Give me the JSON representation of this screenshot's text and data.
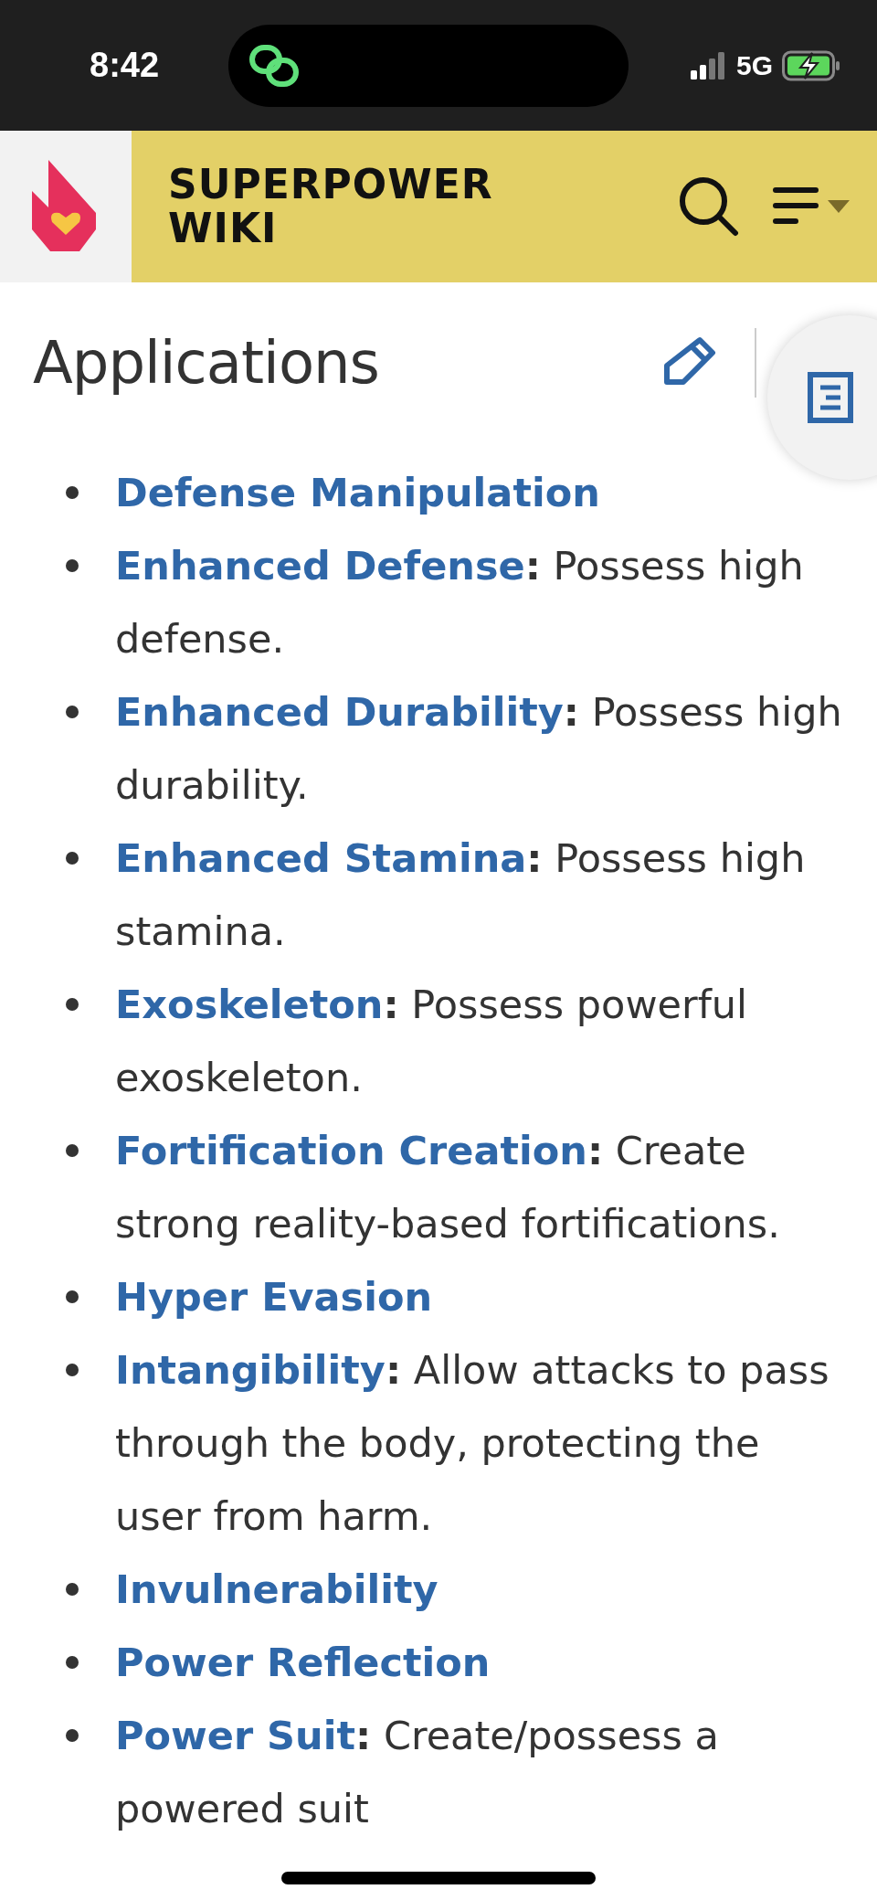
{
  "status_bar": {
    "time": "8:42",
    "network": "5G"
  },
  "header": {
    "title": "SUPERPOWER WIKI"
  },
  "section": {
    "heading": "Applications"
  },
  "items": [
    {
      "link": "Defense Manipulation"
    },
    {
      "link": "Enhanced Defense",
      "separator": ":",
      "text": "Possess high defense."
    },
    {
      "link": "Enhanced Durability",
      "separator": ":",
      "text": "Possess high durability."
    },
    {
      "link": "Enhanced Stamina",
      "separator": ":",
      "text": "Possess high stamina."
    },
    {
      "link": "Exoskeleton",
      "separator": ":",
      "text": "Possess powerful exoskeleton."
    },
    {
      "link": "Fortification Creation",
      "separator": ":",
      "text": "Create strong reality-based fortifications."
    },
    {
      "link": "Hyper Evasion"
    },
    {
      "link": "Intangibility",
      "separator": ":",
      "text": "Allow attacks to pass through the body, protecting the user from harm."
    },
    {
      "link": "Invulnerability"
    },
    {
      "link": "Power Reflection"
    },
    {
      "link": "Power Suit",
      "separator": ":",
      "text": "Create/possess a powered suit"
    }
  ]
}
